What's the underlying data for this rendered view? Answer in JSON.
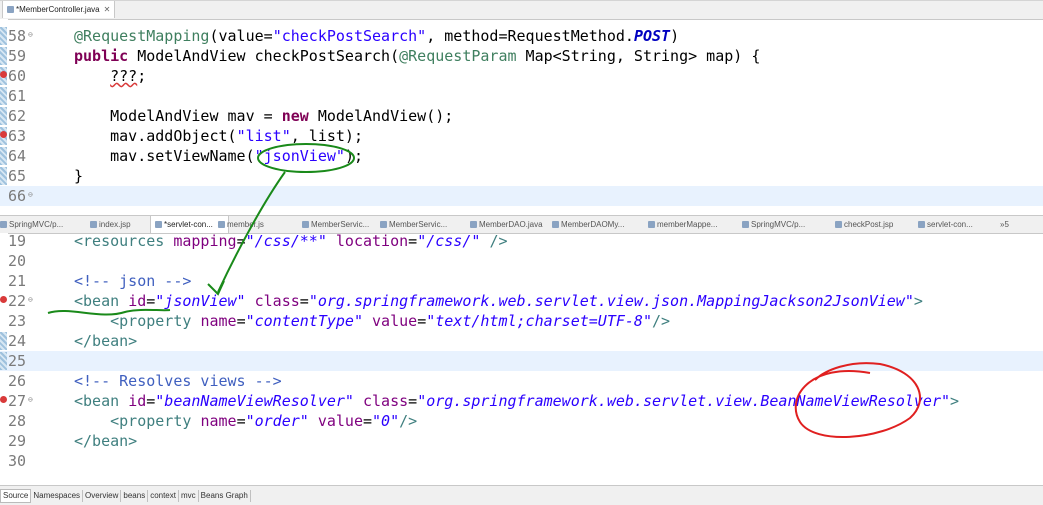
{
  "top_tab": {
    "label": "*MemberController.java"
  },
  "top_code": [
    {
      "n": "58",
      "parts": [
        [
          "ann",
          "@RequestMapping"
        ],
        [
          "",
          "(value="
        ],
        [
          "str",
          "\"checkPostSearch\""
        ],
        [
          "",
          ", method=RequestMethod."
        ],
        [
          "cst",
          "POST"
        ],
        [
          "",
          ")"
        ]
      ]
    },
    {
      "n": "59",
      "parts": [
        [
          "kw",
          "public"
        ],
        [
          "",
          " ModelAndView checkPostSearch("
        ],
        [
          "ann",
          "@RequestParam"
        ],
        [
          "",
          " Map<String, String> map) {"
        ]
      ]
    },
    {
      "n": "60",
      "parts": [
        [
          "",
          "    "
        ],
        [
          "squig",
          "???"
        ],
        [
          "",
          ";"
        ]
      ]
    },
    {
      "n": "61",
      "parts": []
    },
    {
      "n": "62",
      "parts": [
        [
          "",
          "    ModelAndView mav = "
        ],
        [
          "kw",
          "new"
        ],
        [
          "",
          " ModelAndView();"
        ]
      ]
    },
    {
      "n": "63",
      "parts": [
        [
          "",
          "    mav.addObject("
        ],
        [
          "str",
          "\"list\""
        ],
        [
          "",
          ", list);"
        ]
      ]
    },
    {
      "n": "64",
      "parts": [
        [
          "",
          "    mav.setViewName("
        ],
        [
          "str",
          "\"jsonView\""
        ],
        [
          "",
          ");"
        ]
      ]
    },
    {
      "n": "65",
      "parts": [
        [
          "",
          "}"
        ]
      ]
    },
    {
      "n": "66",
      "parts": []
    }
  ],
  "mid_tabs": [
    {
      "label": "SpringMVC/p...",
      "active": false
    },
    {
      "label": "index.jsp",
      "active": false
    },
    {
      "label": "*servlet-con...",
      "active": true
    },
    {
      "label": "member.js",
      "active": false
    },
    {
      "label": "MemberServic...",
      "active": false
    },
    {
      "label": "MemberServic...",
      "active": false
    },
    {
      "label": "MemberDAO.java",
      "active": false
    },
    {
      "label": "MemberDAOMy...",
      "active": false
    },
    {
      "label": "memberMappe...",
      "active": false
    },
    {
      "label": "SpringMVC/p...",
      "active": false
    },
    {
      "label": "checkPost.jsp",
      "active": false
    },
    {
      "label": "servlet-con...",
      "active": false
    },
    {
      "label": "»5",
      "active": false
    }
  ],
  "bottom_code": [
    {
      "n": "19",
      "parts": [
        [
          "tag",
          "<resources"
        ],
        [
          "",
          " "
        ],
        [
          "attr",
          "mapping"
        ],
        [
          "",
          "="
        ],
        [
          "val",
          "\"/css/**\""
        ],
        [
          "",
          " "
        ],
        [
          "attr",
          "location"
        ],
        [
          "",
          "="
        ],
        [
          "val",
          "\"/css/\""
        ],
        [
          "",
          " "
        ],
        [
          "tag",
          "/>"
        ]
      ]
    },
    {
      "n": "20",
      "parts": []
    },
    {
      "n": "21",
      "parts": [
        [
          "cmt",
          "<!-- json -->"
        ]
      ]
    },
    {
      "n": "22",
      "parts": [
        [
          "tag",
          "<bean"
        ],
        [
          "",
          " "
        ],
        [
          "attr",
          "id"
        ],
        [
          "",
          "="
        ],
        [
          "val",
          "\"jsonView\""
        ],
        [
          "",
          " "
        ],
        [
          "attr",
          "class"
        ],
        [
          "",
          "="
        ],
        [
          "val",
          "\"org.springframework.web.servlet.view.json.MappingJackson2JsonView\""
        ],
        [
          "tag",
          ">"
        ]
      ]
    },
    {
      "n": "23",
      "parts": [
        [
          "",
          "    "
        ],
        [
          "tag",
          "<property"
        ],
        [
          "",
          " "
        ],
        [
          "attr",
          "name"
        ],
        [
          "",
          "="
        ],
        [
          "val",
          "\"contentType\""
        ],
        [
          "",
          " "
        ],
        [
          "attr",
          "value"
        ],
        [
          "",
          "="
        ],
        [
          "val",
          "\"text/html;charset=UTF-8\""
        ],
        [
          "tag",
          "/>"
        ]
      ]
    },
    {
      "n": "24",
      "parts": [
        [
          "tag",
          "</bean>"
        ]
      ]
    },
    {
      "n": "25",
      "parts": []
    },
    {
      "n": "26",
      "parts": [
        [
          "cmt",
          "<!-- Resolves views -->"
        ]
      ]
    },
    {
      "n": "27",
      "parts": [
        [
          "tag",
          "<bean"
        ],
        [
          "",
          " "
        ],
        [
          "attr",
          "id"
        ],
        [
          "",
          "="
        ],
        [
          "val",
          "\"beanNameViewResolver\""
        ],
        [
          "",
          " "
        ],
        [
          "attr",
          "class"
        ],
        [
          "",
          "="
        ],
        [
          "val",
          "\"org.springframework.web.servlet.view.BeanNameViewResolver\""
        ],
        [
          "tag",
          ">"
        ]
      ]
    },
    {
      "n": "28",
      "parts": [
        [
          "",
          "    "
        ],
        [
          "tag",
          "<property"
        ],
        [
          "",
          " "
        ],
        [
          "attr",
          "name"
        ],
        [
          "",
          "="
        ],
        [
          "val",
          "\"order\""
        ],
        [
          "",
          " "
        ],
        [
          "attr",
          "value"
        ],
        [
          "",
          "="
        ],
        [
          "val",
          "\"0\""
        ],
        [
          "tag",
          "/>"
        ]
      ]
    },
    {
      "n": "29",
      "parts": [
        [
          "tag",
          "</bean>"
        ]
      ]
    },
    {
      "n": "30",
      "parts": []
    }
  ],
  "bottom_tabs": [
    "Source",
    "Namespaces",
    "Overview",
    "beans",
    "context",
    "mvc",
    "Beans Graph"
  ]
}
